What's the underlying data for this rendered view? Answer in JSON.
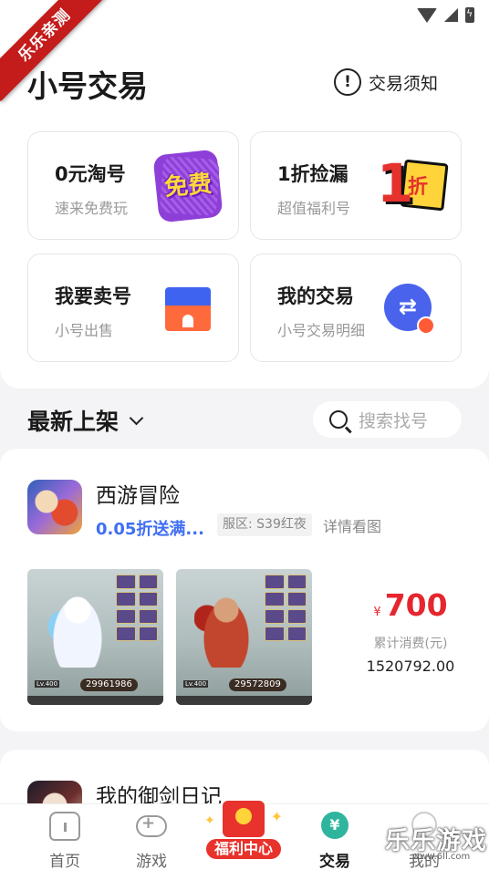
{
  "ribbon": "乐乐亲测",
  "header": {
    "title": "小号交易",
    "notice_label": "交易须知"
  },
  "cards": [
    {
      "title": "0元淘号",
      "sub": "速来免费玩",
      "badge_text": "免费"
    },
    {
      "title": "1折捡漏",
      "sub": "超值福利号",
      "badge_num": "1",
      "badge_text": "折"
    },
    {
      "title": "我要卖号",
      "sub": "小号出售"
    },
    {
      "title": "我的交易",
      "sub": "小号交易明细"
    }
  ],
  "section": {
    "title": "最新上架",
    "search_placeholder": "搜索找号"
  },
  "listings": [
    {
      "game": "西游冒险",
      "promo": "0.05折送满...",
      "server": "服区: S39红夜",
      "detail": "详情看图",
      "shots": [
        {
          "power": "29961986",
          "lv": "Lv.400"
        },
        {
          "power": "29572809",
          "lv": "Lv.400"
        }
      ],
      "price_symbol": "¥",
      "price": "700",
      "spent_label": "累计消费(元)",
      "spent_value": "1520792.00"
    },
    {
      "game": "我的御剑日记"
    }
  ],
  "tabbar": {
    "tabs": [
      {
        "label": "首页"
      },
      {
        "label": "游戏"
      },
      {
        "label": "交易"
      },
      {
        "label": "我的"
      }
    ],
    "welfare_label": "福利中心"
  },
  "watermark": {
    "text": "乐乐游戏",
    "url": "www.6ll.com"
  },
  "colors": {
    "accent": "#3f6ef3",
    "price": "#e5262e",
    "ribbon": "#c41b1b",
    "page_bg": "#f4f4f6"
  }
}
